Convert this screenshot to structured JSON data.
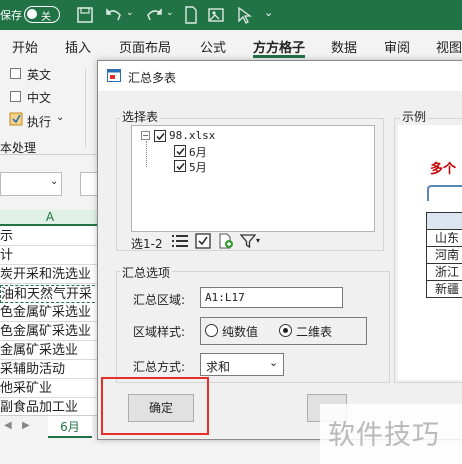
{
  "titlebar": {
    "autosave": "保存",
    "toggle_state": "关"
  },
  "tabs": [
    "开始",
    "插入",
    "页面布局",
    "公式",
    "方方格子",
    "数据",
    "审阅",
    "视图"
  ],
  "active_tab": "方方格子",
  "ribbon": {
    "english": "英文",
    "chinese": "中文",
    "execute": "执行",
    "group_label": "本处理"
  },
  "sheet": {
    "column": "A",
    "rows": [
      "示",
      "计",
      "炭开采和洗选业",
      "油和天然气开采",
      "色金属矿采选业",
      "色金属矿采选业",
      "金属矿采选业",
      "采辅助活动",
      "他采矿业",
      "副食品加工业"
    ],
    "sheet_tab": "6月"
  },
  "dialog": {
    "title": "汇总多表",
    "select_group": "选择表",
    "tree": {
      "root": "98.xlsx",
      "children": [
        "6月",
        "5月"
      ]
    },
    "selected_count": "选1-2",
    "options_group": "汇总选项",
    "range_label": "汇总区域:",
    "range_value": "A1:L17",
    "style_label": "区域样式:",
    "style_options": [
      "纯数值",
      "二维表"
    ],
    "style_selected": "二维表",
    "method_label": "汇总方式:",
    "method_value": "求和",
    "ok_button": "确定",
    "example_group": "示例",
    "example": {
      "heading": "多个",
      "rows": [
        "山东",
        "河南",
        "浙江",
        "新疆"
      ]
    }
  },
  "watermark": "软件技巧",
  "colors": {
    "excel_green": "#217346",
    "highlight_red": "#e5302a",
    "example_red": "#c00000"
  }
}
